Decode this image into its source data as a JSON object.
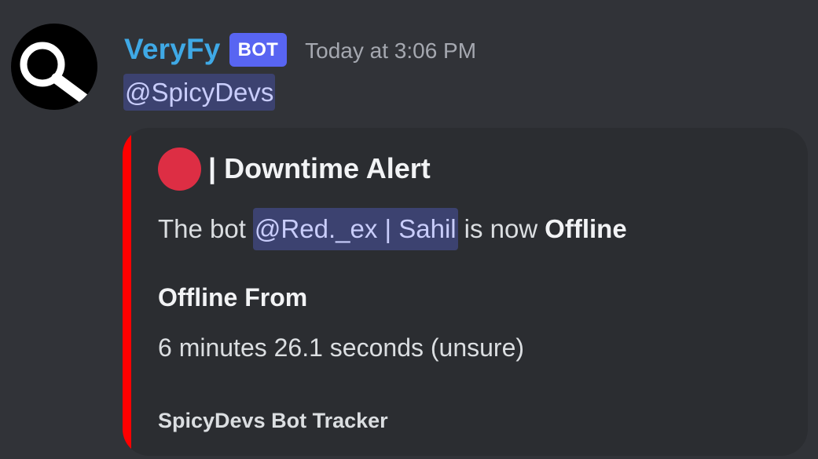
{
  "message": {
    "author": {
      "username": "VeryFy",
      "tag": "BOT",
      "avatar_icon": "magnifying-glass-icon",
      "username_color": "#3fa9e6"
    },
    "timestamp": "Today at 3:06 PM",
    "mention": "@SpicyDevs"
  },
  "embed": {
    "accent_color": "#ff0000",
    "title_icon": "red-circle-icon",
    "title": "| Downtime Alert",
    "description": {
      "prefix": "The bot",
      "mention": "@Red._ex | Sahil",
      "middle": "is now",
      "status": "Offline"
    },
    "field": {
      "name": "Offline From",
      "value": "6 minutes 26.1 seconds (unsure)"
    },
    "footer": "SpicyDevs Bot Tracker"
  }
}
